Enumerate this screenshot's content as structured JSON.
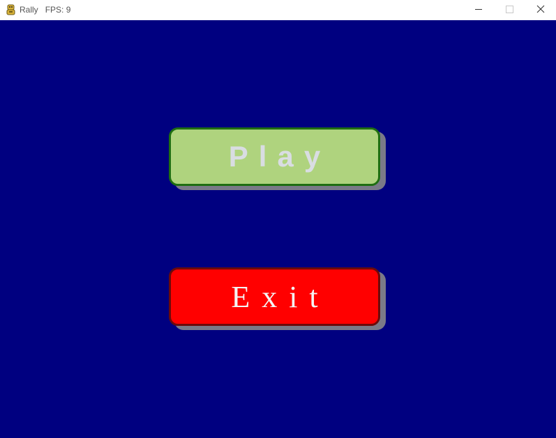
{
  "window": {
    "app_name": "Rally",
    "fps_text": "FPS: 9",
    "icon": "python-snake-icon",
    "controls": [
      "minimize-icon",
      "maximize-icon",
      "close-icon"
    ]
  },
  "menu": {
    "background_color": "#000080",
    "buttons": [
      {
        "label": "Play",
        "color": "#afd37e",
        "border_color": "#1f6e12",
        "text_color": "#d9dde2"
      },
      {
        "label": "Exit",
        "color": "#ff0000",
        "border_color": "#6b0b0b",
        "text_color": "#f4f4f4"
      }
    ]
  }
}
